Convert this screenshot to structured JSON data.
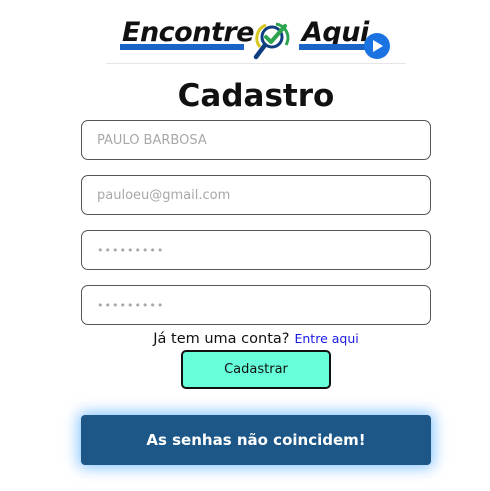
{
  "logo": {
    "word_left": "Encontre",
    "word_right": "Aqui",
    "icon": "magnifier-check-icon",
    "arrow_icon": "play-arrow-icon",
    "colors": {
      "blue": "#1a63c7",
      "green": "#2ea44f",
      "yellow": "#d8c81e"
    }
  },
  "title": "Cadastro",
  "form": {
    "name": {
      "value": "",
      "placeholder": "PAULO BARBOSA"
    },
    "email": {
      "value": "",
      "placeholder": "pauloeu@gmail.com"
    },
    "password": {
      "value": "",
      "placeholder": "•••••••••"
    },
    "confirm_password": {
      "value": "",
      "placeholder": "•••••••••"
    },
    "login_prompt": "Já tem uma conta?",
    "login_link": "Entre aqui",
    "submit_label": "Cadastrar"
  },
  "alert": {
    "message": "As senhas não coincidem!"
  },
  "colors": {
    "submit_bg": "#66ffd9",
    "alert_bg": "#1c5788",
    "link": "#1a1ae6"
  }
}
